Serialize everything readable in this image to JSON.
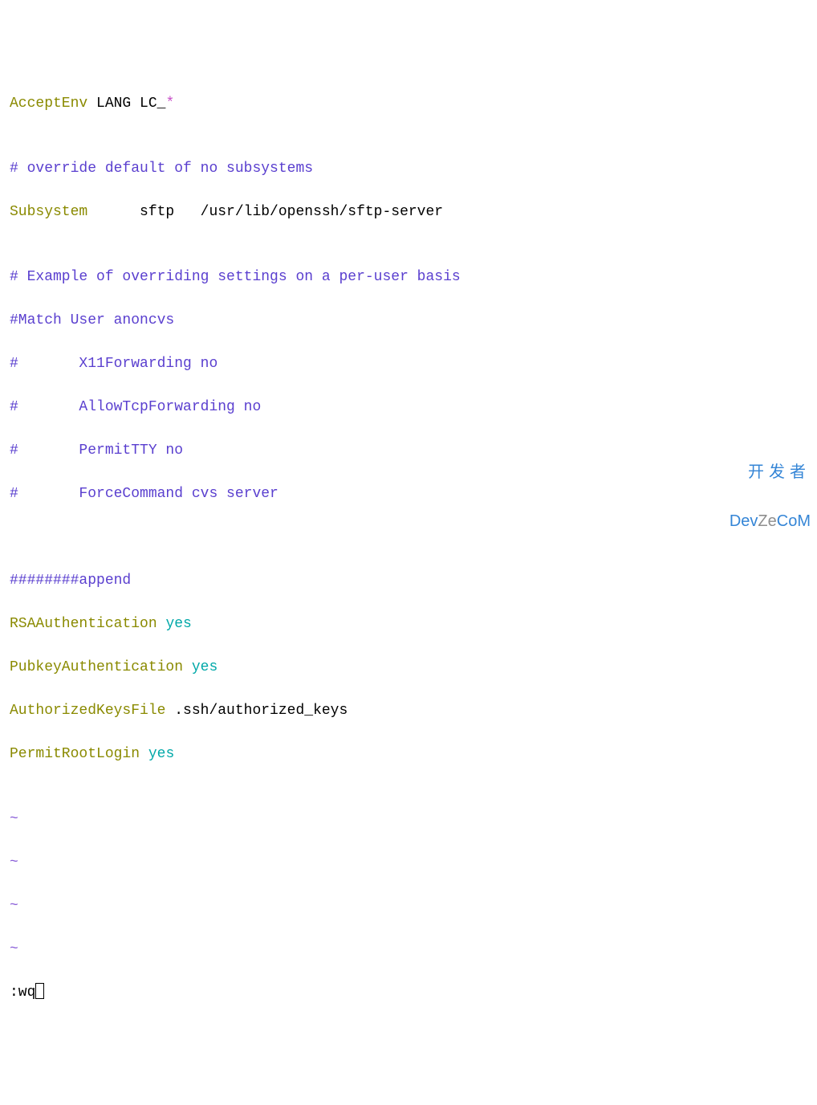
{
  "lines": {
    "l1_acceptenv": "AcceptEnv",
    "l1_args": " LANG LC_",
    "l1_star": "*",
    "blank": "",
    "l3_comment": "# override default of no subsystems",
    "l4_subsystem": "Subsystem",
    "l4_rest": "      sftp   /usr/lib/openssh/sftp-server",
    "l6_comment": "# Example of overriding settings on a per-user basis",
    "l7_comment": "#Match User anoncvs",
    "l8_comment": "#       X11Forwarding no",
    "l9_comment": "#       AllowTcpForwarding no",
    "l10_comment": "#       PermitTTY no",
    "l11_comment": "#       ForceCommand cvs server",
    "l14_append": "########append",
    "l15_key": "RSAAuthentication",
    "l15_sp": " ",
    "l15_val": "yes",
    "l16_key": "PubkeyAuthentication",
    "l16_sp": " ",
    "l16_val": "yes",
    "l17_key": "AuthorizedKeysFile",
    "l17_rest": " .ssh/authorized_keys",
    "l18_key": "PermitRootLogin",
    "l18_sp": " ",
    "l18_val": "yes",
    "tilde": "~",
    "cmd": ":wq"
  },
  "watermark": {
    "top": "开发者",
    "dev": "Dev",
    "ze": "Ze",
    "com": "CoM"
  }
}
